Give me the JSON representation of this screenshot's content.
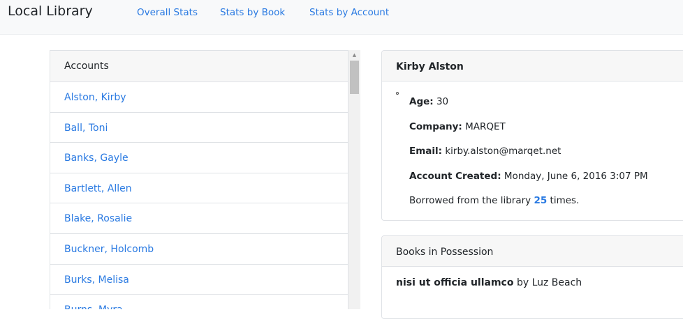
{
  "navbar": {
    "brand": "Local Library",
    "links": [
      "Overall Stats",
      "Stats by Book",
      "Stats by Account"
    ]
  },
  "accounts": {
    "header": "Accounts",
    "items": [
      "Alston, Kirby",
      "Ball, Toni",
      "Banks, Gayle",
      "Bartlett, Allen",
      "Blake, Rosalie",
      "Buckner, Holcomb",
      "Burks, Melisa",
      "Burns, Myra"
    ]
  },
  "detail": {
    "name": "Kirby Alston",
    "age_label": "Age:",
    "age": "30",
    "company_label": "Company:",
    "company": "MARQET",
    "email_label": "Email:",
    "email": "kirby.alston@marqet.net",
    "created_label": "Account Created:",
    "created": "Monday, June 6, 2016 3:07 PM",
    "borrowed_prefix": "Borrowed from the library",
    "borrowed_count": "25",
    "borrowed_suffix": "times."
  },
  "books": {
    "header": "Books in Possession",
    "items": [
      {
        "title": "nisi ut officia ullamco",
        "by": "by",
        "author": "Luz Beach"
      }
    ]
  },
  "colors": {
    "link": "#2a7ae2",
    "navbar_bg": "#f8f9fa",
    "card_header_bg": "#f7f7f7",
    "border": "#dfe2e6"
  }
}
